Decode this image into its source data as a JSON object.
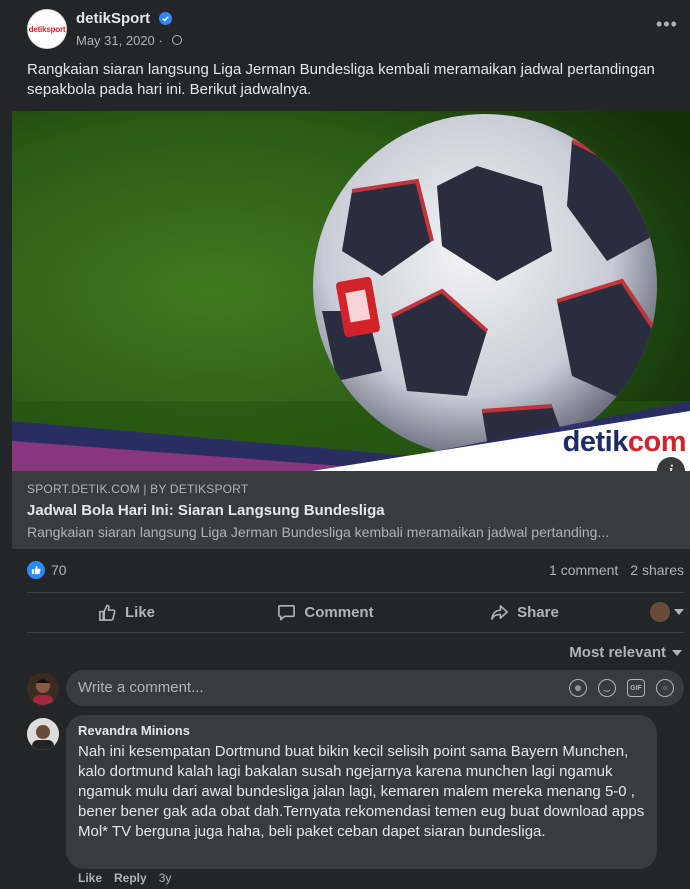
{
  "post": {
    "page_name": "detikSport",
    "date": "May 31, 2020 ·",
    "text": "Rangkaian siaran langsung Liga Jerman Bundesliga kembali meramaikan jadwal pertandingan sepakbola pada hari ini. Berikut jadwalnya.",
    "avatar_logo": "detiksport",
    "image_brand_1": "detik",
    "image_brand_2": "com"
  },
  "link": {
    "domain": "SPORT.DETIK.COM | BY DETIKSPORT",
    "title": "Jadwal Bola Hari Ini: Siaran Langsung Bundesliga",
    "description": "Rangkaian siaran langsung Liga Jerman Bundesliga kembali meramaikan jadwal pertanding..."
  },
  "stats": {
    "reactions": "70",
    "comments": "1 comment",
    "shares": "2 shares"
  },
  "actions": {
    "like": "Like",
    "comment": "Comment",
    "share": "Share"
  },
  "comments_section": {
    "sort_label": "Most relevant",
    "input_placeholder": "Write a comment...",
    "input_icons": [
      "sticker-icon",
      "emoji-icon",
      "gif-icon",
      "sticker-alt-icon"
    ]
  },
  "comment": {
    "author": "Revandra Minions",
    "text": "Nah ini kesempatan Dortmund buat bikin kecil selisih point sama Bayern Munchen, kalo dortmund kalah lagi bakalan susah ngejarnya karena munchen lagi ngamuk ngamuk mulu dari awal bundesliga jalan lagi, kemaren malem mereka menang 5-0 , bener bener gak ada obat dah.Ternyata rekomendasi temen eug buat download apps Mol* TV berguna juga haha, beli paket ceban dapet siaran bundesliga.",
    "like": "Like",
    "reply": "Reply",
    "age": "3y"
  },
  "colors": {
    "background": "#242526",
    "surface": "#3a3b3c",
    "accent": "#2d88ff",
    "brand_red": "#d2232a",
    "brand_navy": "#1d2c63"
  }
}
